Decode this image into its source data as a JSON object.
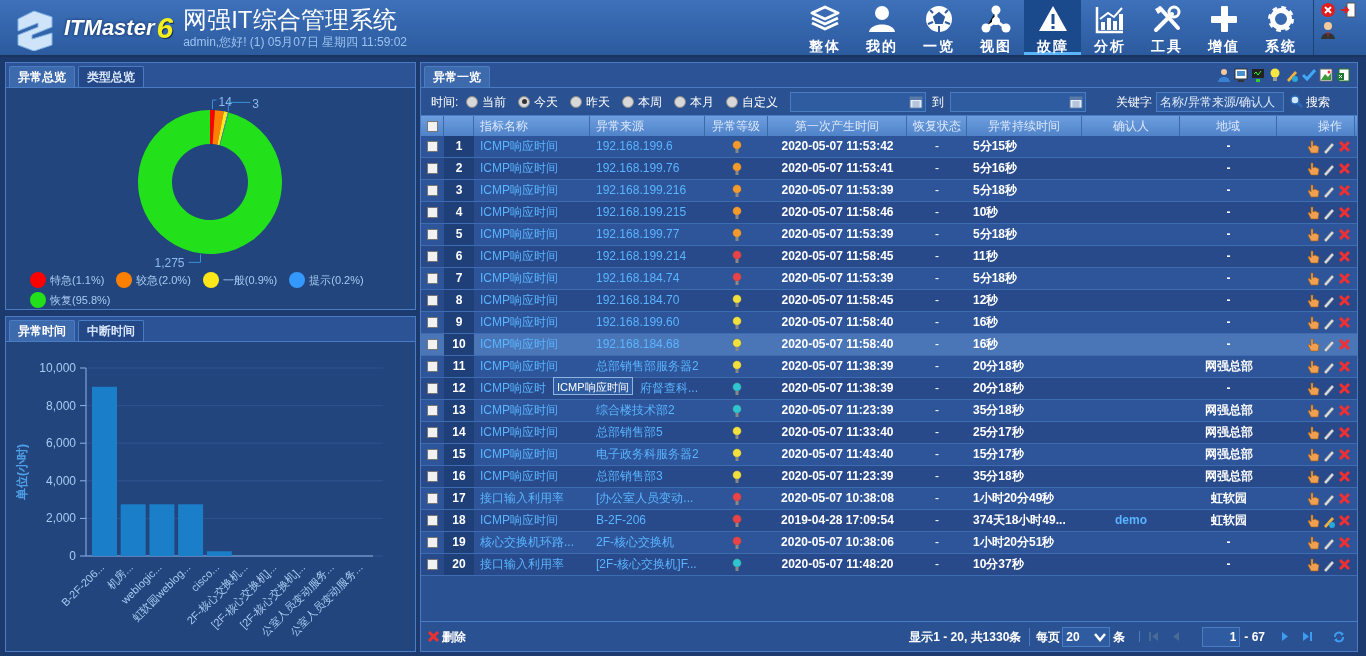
{
  "header": {
    "logo_text": "ITMaster",
    "logo_version": "6",
    "title": "网强IT综合管理系统",
    "greeting": "admin,您好! (1) 05月07日 星期四 11:59:02"
  },
  "nav": [
    {
      "label": "整体",
      "kind": "layers",
      "selected": false
    },
    {
      "label": "我的",
      "kind": "user",
      "selected": false
    },
    {
      "label": "一览",
      "kind": "ball",
      "selected": false
    },
    {
      "label": "视图",
      "kind": "topology",
      "selected": false
    },
    {
      "label": "故障",
      "kind": "warning",
      "selected": true
    },
    {
      "label": "分析",
      "kind": "chart",
      "selected": false
    },
    {
      "label": "工具",
      "kind": "tools",
      "selected": false
    },
    {
      "label": "增值",
      "kind": "plus",
      "selected": false
    },
    {
      "label": "系统",
      "kind": "gear",
      "selected": false
    }
  ],
  "overview_panel": {
    "tabs": [
      {
        "label": "异常总览",
        "selected": true
      },
      {
        "label": "类型总览",
        "selected": false
      }
    ],
    "chart_data": {
      "type": "donut",
      "categories": [
        "特急(1.1%)",
        "较急(2.0%)",
        "一般(0.9%)",
        "提示(0.2%)",
        "恢复(95.8%)"
      ],
      "values": [
        1.1,
        2.0,
        0.9,
        0.2,
        95.8
      ],
      "colors": [
        "#ff0000",
        "#ff7f00",
        "#ffe81a",
        "#3399ff",
        "#22e01a"
      ],
      "annotations": [
        {
          "text": "14"
        },
        {
          "text": "3"
        },
        {
          "text": "1,275"
        }
      ]
    }
  },
  "time_panel": {
    "tabs": [
      {
        "label": "异常时间",
        "selected": true
      },
      {
        "label": "中断时间",
        "selected": false
      }
    ],
    "chart_data": {
      "type": "bar",
      "grid": true,
      "ylabel": "单位(小时)",
      "categories": [
        "B-2F-206...",
        "机房...",
        "weblogic...",
        "虹软园weblog...",
        "cisco...",
        "2F-核心交换机...",
        "[2F-核心交换机]...",
        "[2F-核心交换机]...",
        "公室人员变动服务...",
        "公室人员变动服务..."
      ],
      "values": [
        9000,
        2750,
        2750,
        2750,
        250,
        0,
        0,
        0,
        0,
        0
      ],
      "ylim": [
        0,
        10000
      ],
      "yticks": [
        {
          "value": 0,
          "label": "0"
        },
        {
          "value": 2000,
          "label": "2,000"
        },
        {
          "value": 4000,
          "label": "4,000"
        },
        {
          "value": 6000,
          "label": "6,000"
        },
        {
          "value": 8000,
          "label": "8,000"
        },
        {
          "value": 10000,
          "label": "10,000"
        }
      ]
    }
  },
  "list_panel": {
    "tabs": [
      {
        "label": "异常一览",
        "selected": true
      }
    ],
    "select_all_checked": false,
    "filter": {
      "time_label": "时间:",
      "ranges": [
        {
          "label": "当前",
          "selected": false
        },
        {
          "label": "今天",
          "selected": true
        },
        {
          "label": "昨天",
          "selected": false
        },
        {
          "label": "本周",
          "selected": false
        },
        {
          "label": "本月",
          "selected": false
        },
        {
          "label": "自定义",
          "selected": false
        }
      ],
      "to_label": "到",
      "keyword_label": "关键字",
      "keyword_placeholder": "名称/异常来源/确认人",
      "search_button": "搜索"
    },
    "columns": [
      "指标名称",
      "异常来源",
      "异常等级",
      "第一次产生时间",
      "恢复状态",
      "异常持续时间",
      "确认人",
      "地域",
      "操作"
    ],
    "rows": [
      {
        "no": "1",
        "name": "ICMP响应时间",
        "source": "192.168.199.6",
        "color": "#f39a2e",
        "first_time": "2020-05-07 11:53:42",
        "recovery": "-",
        "duration": "5分15秒",
        "region": "-",
        "selected": false,
        "checked": false,
        "confirmed": false
      },
      {
        "no": "2",
        "name": "ICMP响应时间",
        "source": "192.168.199.76",
        "color": "#f39a2e",
        "first_time": "2020-05-07 11:53:41",
        "recovery": "-",
        "duration": "5分16秒",
        "region": "-",
        "selected": false,
        "checked": false,
        "confirmed": false
      },
      {
        "no": "3",
        "name": "ICMP响应时间",
        "source": "192.168.199.216",
        "color": "#f39a2e",
        "first_time": "2020-05-07 11:53:39",
        "recovery": "-",
        "duration": "5分18秒",
        "region": "-",
        "selected": false,
        "checked": false,
        "confirmed": false
      },
      {
        "no": "4",
        "name": "ICMP响应时间",
        "source": "192.168.199.215",
        "color": "#f39a2e",
        "first_time": "2020-05-07 11:58:46",
        "recovery": "-",
        "duration": "10秒",
        "region": "-",
        "selected": false,
        "checked": false,
        "confirmed": false
      },
      {
        "no": "5",
        "name": "ICMP响应时间",
        "source": "192.168.199.77",
        "color": "#f39a2e",
        "first_time": "2020-05-07 11:53:39",
        "recovery": "-",
        "duration": "5分18秒",
        "region": "-",
        "selected": false,
        "checked": false,
        "confirmed": false
      },
      {
        "no": "6",
        "name": "ICMP响应时间",
        "source": "192.168.199.214",
        "color": "#e8424a",
        "first_time": "2020-05-07 11:58:45",
        "recovery": "-",
        "duration": "11秒",
        "region": "-",
        "selected": false,
        "checked": false,
        "confirmed": false
      },
      {
        "no": "7",
        "name": "ICMP响应时间",
        "source": "192.168.184.74",
        "color": "#e8424a",
        "first_time": "2020-05-07 11:53:39",
        "recovery": "-",
        "duration": "5分18秒",
        "region": "-",
        "selected": false,
        "checked": false,
        "confirmed": false
      },
      {
        "no": "8",
        "name": "ICMP响应时间",
        "source": "192.168.184.70",
        "color": "#f0e040",
        "first_time": "2020-05-07 11:58:45",
        "recovery": "-",
        "duration": "12秒",
        "region": "-",
        "selected": false,
        "checked": false,
        "confirmed": false
      },
      {
        "no": "9",
        "name": "ICMP响应时间",
        "source": "192.168.199.60",
        "color": "#f0e040",
        "first_time": "2020-05-07 11:58:40",
        "recovery": "-",
        "duration": "16秒",
        "region": "-",
        "selected": false,
        "checked": false,
        "confirmed": false
      },
      {
        "no": "10",
        "name": "ICMP响应时间",
        "source": "192.168.184.68",
        "color": "#f0e040",
        "first_time": "2020-05-07 11:58:40",
        "recovery": "-",
        "duration": "16秒",
        "region": "-",
        "selected": true,
        "checked": false,
        "confirmed": false
      },
      {
        "no": "11",
        "name": "ICMP响应时间",
        "source": "总部销售部服务器2",
        "color": "#f0e040",
        "first_time": "2020-05-07 11:38:39",
        "recovery": "-",
        "duration": "20分18秒",
        "region": "网强总部",
        "selected": false,
        "checked": false,
        "confirmed": false
      },
      {
        "no": "12",
        "name": "ICMP响应时",
        "source": "府督查科...",
        "color": "#2ec4d0",
        "first_time": "2020-05-07 11:38:39",
        "recovery": "-",
        "duration": "20分18秒",
        "region": "-",
        "selected": false,
        "checked": false,
        "confirmed": false,
        "tooltip": "ICMP响应时间"
      },
      {
        "no": "13",
        "name": "ICMP响应时间",
        "source": "综合楼技术部2",
        "color": "#2ec4d0",
        "first_time": "2020-05-07 11:23:39",
        "recovery": "-",
        "duration": "35分18秒",
        "region": "网强总部",
        "selected": false,
        "checked": false,
        "confirmed": false
      },
      {
        "no": "14",
        "name": "ICMP响应时间",
        "source": "总部销售部5",
        "color": "#f0e040",
        "first_time": "2020-05-07 11:33:40",
        "recovery": "-",
        "duration": "25分17秒",
        "region": "网强总部",
        "selected": false,
        "checked": false,
        "confirmed": false
      },
      {
        "no": "15",
        "name": "ICMP响应时间",
        "source": "电子政务科服务器2",
        "color": "#f0e040",
        "first_time": "2020-05-07 11:43:40",
        "recovery": "-",
        "duration": "15分17秒",
        "region": "网强总部",
        "selected": false,
        "checked": false,
        "confirmed": false
      },
      {
        "no": "16",
        "name": "ICMP响应时间",
        "source": "总部销售部3",
        "color": "#f0e040",
        "first_time": "2020-05-07 11:23:39",
        "recovery": "-",
        "duration": "35分18秒",
        "region": "网强总部",
        "selected": false,
        "checked": false,
        "confirmed": false
      },
      {
        "no": "17",
        "name": "接口输入利用率",
        "source": "[办公室人员变动...",
        "color": "#e8424a",
        "first_time": "2020-05-07 10:38:08",
        "recovery": "-",
        "duration": "1小时20分49秒",
        "region": "虹软园",
        "selected": false,
        "checked": false,
        "confirmed": false
      },
      {
        "no": "18",
        "name": "ICMP响应时间",
        "source": "B-2F-206",
        "color": "#e8424a",
        "first_time": "2019-04-28 17:09:54",
        "recovery": "-",
        "duration": "374天18小时49...",
        "confirmer": "demo",
        "region": "虹软园",
        "selected": false,
        "checked": false,
        "confirmed": true
      },
      {
        "no": "19",
        "name": "核心交换机环路...",
        "source": "2F-核心交换机",
        "color": "#e8424a",
        "first_time": "2020-05-07 10:38:06",
        "recovery": "-",
        "duration": "1小时20分51秒",
        "region": "-",
        "selected": false,
        "checked": false,
        "confirmed": false
      },
      {
        "no": "20",
        "name": "接口输入利用率",
        "source": "[2F-核心交换机]F...",
        "color": "#2ec4d0",
        "first_time": "2020-05-07 11:48:20",
        "recovery": "-",
        "duration": "10分37秒",
        "region": "-",
        "selected": false,
        "checked": false,
        "confirmed": false
      }
    ],
    "footer": {
      "delete_button": "删除",
      "summary": "显示1 - 20, 共1330条",
      "per_page_label": "每页",
      "per_page": "20",
      "per_page_unit": "条",
      "page": "1",
      "page_total": "- 67"
    }
  }
}
